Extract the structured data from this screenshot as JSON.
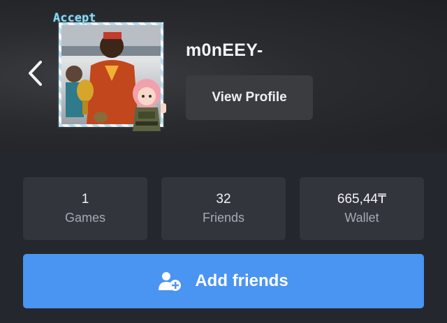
{
  "profile": {
    "username": "m0nEEY-",
    "avatar_frame_text": "Accept",
    "view_profile_label": "View Profile"
  },
  "stats": [
    {
      "value": "1",
      "label": "Games"
    },
    {
      "value": "32",
      "label": "Friends"
    },
    {
      "value": "665,44₸",
      "label": "Wallet"
    }
  ],
  "actions": {
    "add_friends_label": "Add friends"
  },
  "icons": {
    "back": "chevron-left-icon",
    "add_friend": "person-plus-icon"
  },
  "colors": {
    "accent": "#4a94f2",
    "card": "#32353c",
    "background": "#24272d"
  }
}
